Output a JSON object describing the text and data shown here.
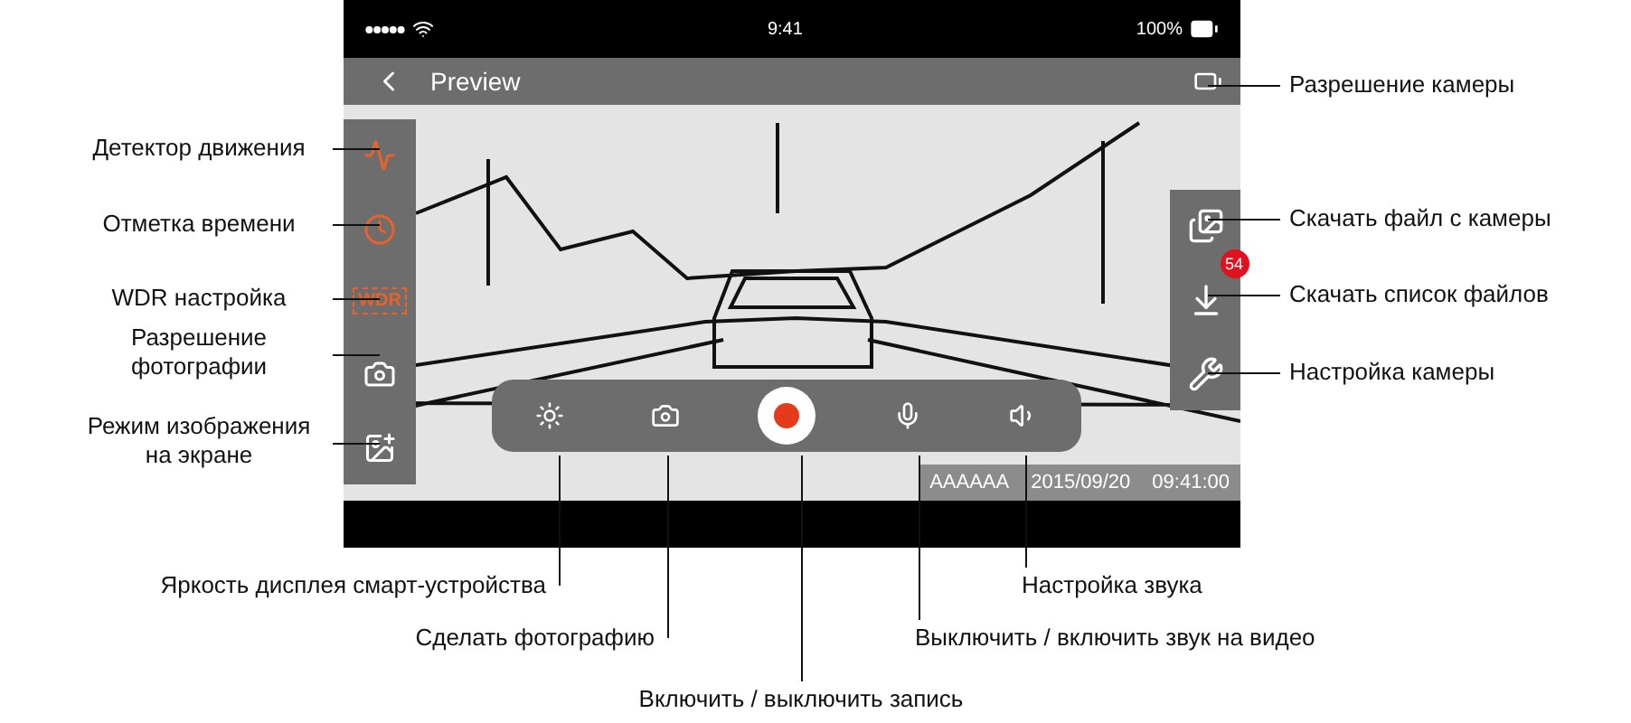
{
  "status_bar": {
    "time": "9:41",
    "battery": "100%"
  },
  "nav": {
    "title": "Preview"
  },
  "left_tools": [
    {
      "kind": "motion",
      "on": true
    },
    {
      "kind": "timestamp",
      "on": true
    },
    {
      "kind": "wdr",
      "on": true,
      "label": "WDR"
    },
    {
      "kind": "photo_resolution",
      "on": false
    },
    {
      "kind": "display_mode",
      "on": false
    }
  ],
  "right_tools": [
    {
      "kind": "gallery"
    },
    {
      "kind": "download",
      "badge": "54"
    },
    {
      "kind": "settings"
    }
  ],
  "controls": [
    {
      "kind": "brightness"
    },
    {
      "kind": "photo"
    },
    {
      "kind": "record"
    },
    {
      "kind": "mic"
    },
    {
      "kind": "sound"
    }
  ],
  "overlay": {
    "label": "AAAAAA",
    "date": "2015/09/20",
    "time": "09:41:00"
  },
  "left_callouts": [
    "Детектор движения",
    "Отметка времени",
    "WDR настройка",
    "Разрешение фотографии",
    "Режим изображения на экране"
  ],
  "right_callouts": [
    "Разрешение камеры",
    "Скачать файл с камеры",
    "Скачать список файлов",
    "Настройка камеры"
  ],
  "bottom_callouts": [
    "Яркость дисплея смарт-устройства",
    "Настройка звука",
    "Сделать фотографию",
    "Выключить / включить звук на видео",
    "Включить / выключить запись"
  ]
}
